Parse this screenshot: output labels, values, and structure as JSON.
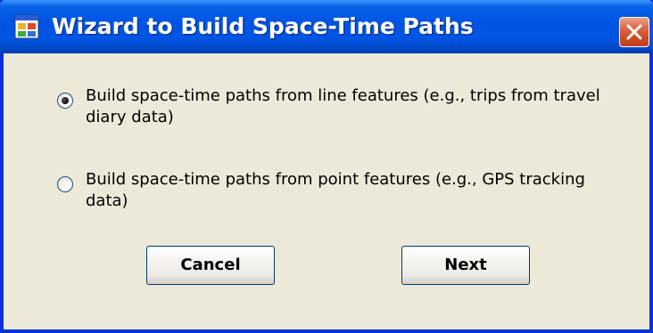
{
  "window": {
    "title": "Wizard to Build Space-Time Paths"
  },
  "options": [
    {
      "label": "Build space-time paths from line features (e.g., trips from travel diary data)",
      "checked": true
    },
    {
      "label": "Build space-time paths from point features (e.g., GPS tracking data)",
      "checked": false
    }
  ],
  "buttons": {
    "cancel_label": "Cancel",
    "next_label": "Next"
  },
  "colors": {
    "titlebar": "#0054E3",
    "window_bg": "#ECE9D8",
    "close_button": "#CC4A25",
    "border": "#0831D9"
  },
  "icons": {
    "title": "window-app-icon",
    "close": "close-icon"
  }
}
